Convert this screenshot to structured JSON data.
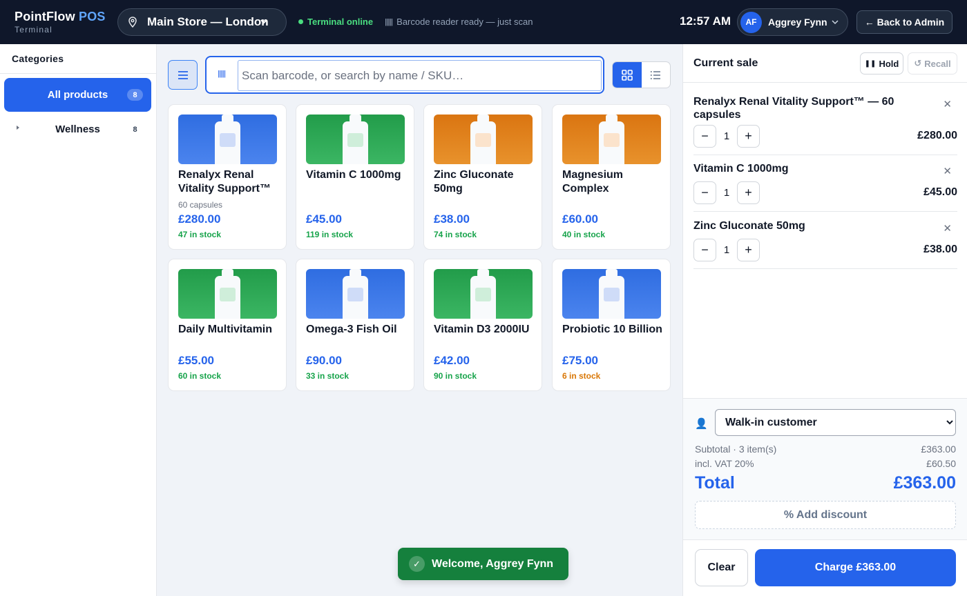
{
  "header": {
    "brand": "PointFlow",
    "brand_accent": "POS",
    "subtitle": "Terminal",
    "store": "Main Store — London",
    "status": "Terminal online",
    "barcode_status": "Barcode reader ready — just scan",
    "clock": "12:57 AM",
    "user_initials": "AF",
    "user_name": "Aggrey Fynn",
    "back_label": "← Back to Admin"
  },
  "sidebar": {
    "title": "Categories",
    "items": [
      {
        "label": "All products",
        "count": "8",
        "active": true
      },
      {
        "label": "Wellness",
        "count": "8",
        "active": false
      }
    ]
  },
  "search": {
    "placeholder": "Scan barcode, or search by name / SKU…",
    "value": ""
  },
  "products": [
    {
      "name": "Renalyx Renal Vitality Support™",
      "sub": "60 capsules",
      "price": "£280.00",
      "stock": "47 in stock",
      "color": "blue"
    },
    {
      "name": "Vitamin C 1000mg",
      "sub": "",
      "price": "£45.00",
      "stock": "119 in stock",
      "color": "green"
    },
    {
      "name": "Zinc Gluconate 50mg",
      "sub": "",
      "price": "£38.00",
      "stock": "74 in stock",
      "color": "orange"
    },
    {
      "name": "Magnesium Complex",
      "sub": "",
      "price": "£60.00",
      "stock": "40 in stock",
      "color": "orange"
    },
    {
      "name": "Daily Multivitamin",
      "sub": "",
      "price": "£55.00",
      "stock": "60 in stock",
      "color": "green"
    },
    {
      "name": "Omega-3 Fish Oil",
      "sub": "",
      "price": "£90.00",
      "stock": "33 in stock",
      "color": "blue"
    },
    {
      "name": "Vitamin D3 2000IU",
      "sub": "",
      "price": "£42.00",
      "stock": "90 in stock",
      "color": "green"
    },
    {
      "name": "Probiotic 10 Billion",
      "sub": "",
      "price": "£75.00",
      "stock": "6 in stock",
      "color": "blue",
      "low": true
    }
  ],
  "toast": "Welcome, Aggrey Fynn",
  "cart": {
    "title": "Current sale",
    "hold_label": "Hold",
    "recall_label": "Recall",
    "lines": [
      {
        "name": "Renalyx Renal Vitality Support™ — 60 capsules",
        "qty": "1",
        "price": "£280.00"
      },
      {
        "name": "Vitamin C 1000mg",
        "qty": "1",
        "price": "£45.00"
      },
      {
        "name": "Zinc Gluconate 50mg",
        "qty": "1",
        "price": "£38.00"
      }
    ],
    "customer_options": [
      "Walk-in customer"
    ],
    "customer_selected": "Walk-in customer",
    "subtotal_label": "Subtotal · 3 item(s)",
    "subtotal_value": "£363.00",
    "vat_label": "incl. VAT 20%",
    "vat_value": "£60.50",
    "total_label": "Total",
    "total_value": "£363.00",
    "discount_label": "% Add discount",
    "clear_label": "Clear",
    "charge_label": "Charge £363.00"
  },
  "colors": {
    "accent": "#2563eb",
    "topbar": "#0f172a",
    "success": "#16a34a",
    "warning": "#d97706"
  }
}
